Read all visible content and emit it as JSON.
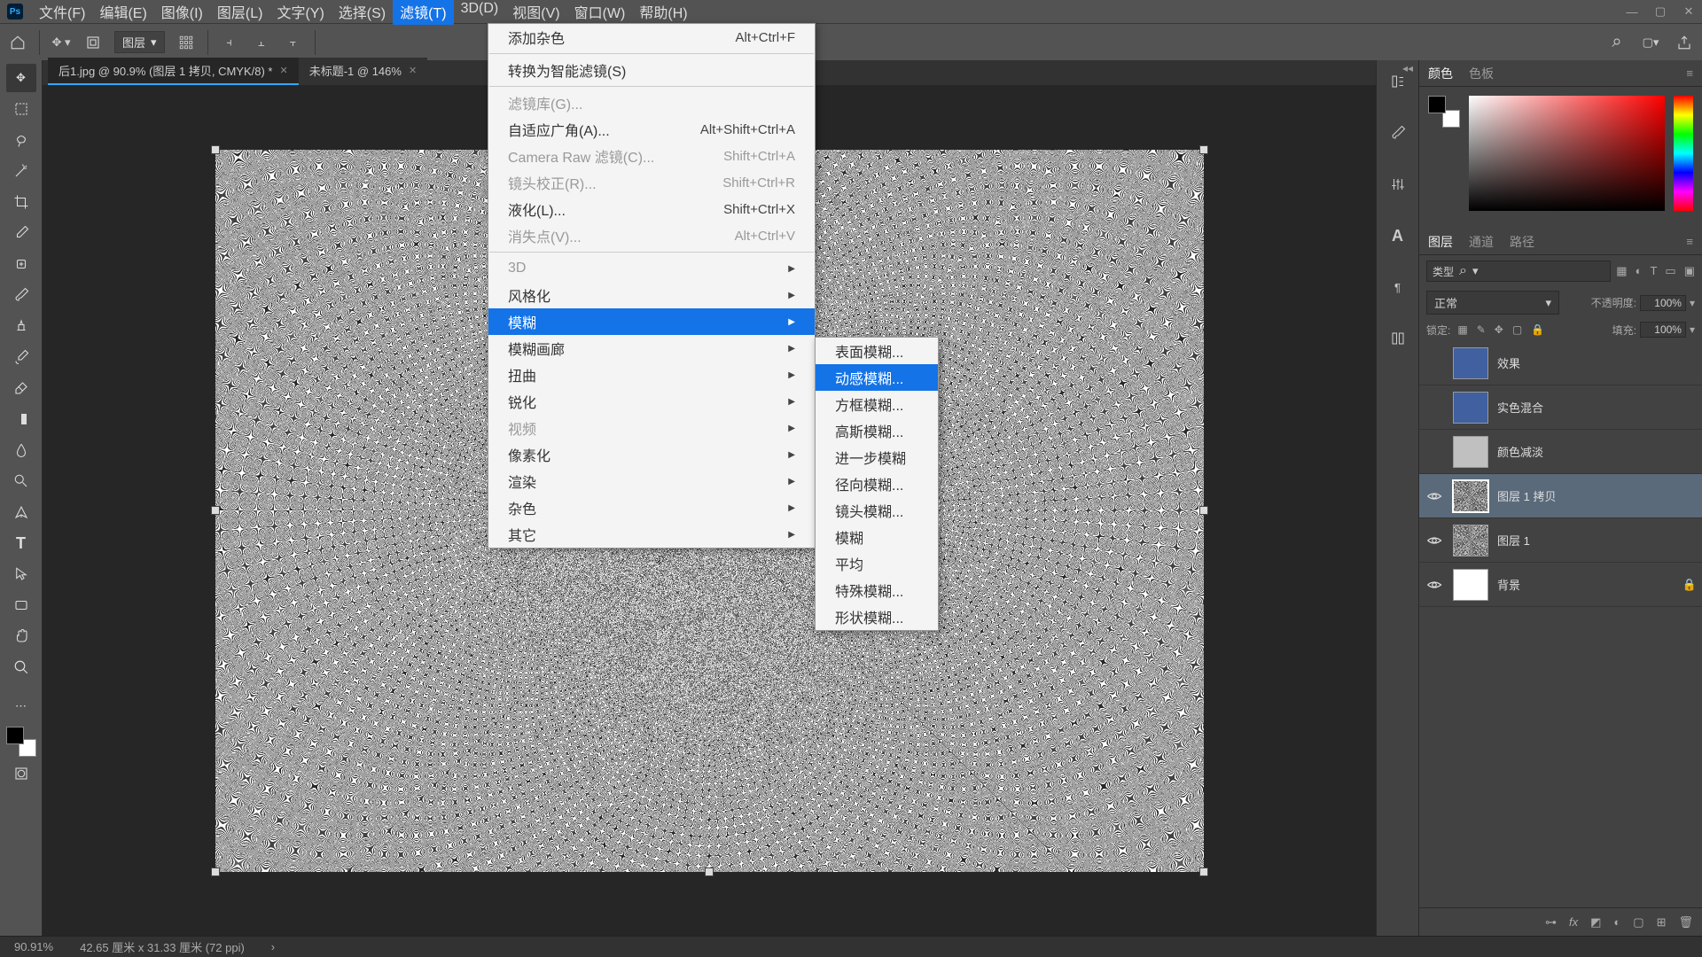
{
  "app": {
    "icon_text": "Ps"
  },
  "menubar": {
    "items": [
      "文件(F)",
      "编辑(E)",
      "图像(I)",
      "图层(L)",
      "文字(Y)",
      "选择(S)",
      "滤镜(T)",
      "3D(D)",
      "视图(V)",
      "窗口(W)",
      "帮助(H)"
    ],
    "active_index": 6
  },
  "optionsbar": {
    "dropdown1": "图层"
  },
  "tabs": [
    {
      "label": "后1.jpg @ 90.9% (图层 1 拷贝, CMYK/8) *",
      "active": true
    },
    {
      "label": "未标题-1 @ 146%",
      "active": false
    }
  ],
  "dropdown_main": [
    {
      "label": "添加杂色",
      "shortcut": "Alt+Ctrl+F"
    },
    {
      "sep": true
    },
    {
      "label": "转换为智能滤镜(S)"
    },
    {
      "sep": true
    },
    {
      "label": "滤镜库(G)...",
      "disabled": true
    },
    {
      "label": "自适应广角(A)...",
      "shortcut": "Alt+Shift+Ctrl+A"
    },
    {
      "label": "Camera Raw 滤镜(C)...",
      "shortcut": "Shift+Ctrl+A",
      "disabled": true
    },
    {
      "label": "镜头校正(R)...",
      "shortcut": "Shift+Ctrl+R",
      "disabled": true
    },
    {
      "label": "液化(L)...",
      "shortcut": "Shift+Ctrl+X"
    },
    {
      "label": "消失点(V)...",
      "shortcut": "Alt+Ctrl+V",
      "disabled": true
    },
    {
      "sep": true
    },
    {
      "label": "3D",
      "arrow": true,
      "disabled": true
    },
    {
      "label": "风格化",
      "arrow": true
    },
    {
      "label": "模糊",
      "arrow": true,
      "selected": true
    },
    {
      "label": "模糊画廊",
      "arrow": true
    },
    {
      "label": "扭曲",
      "arrow": true
    },
    {
      "label": "锐化",
      "arrow": true
    },
    {
      "label": "视频",
      "arrow": true,
      "disabled": true
    },
    {
      "label": "像素化",
      "arrow": true
    },
    {
      "label": "渲染",
      "arrow": true
    },
    {
      "label": "杂色",
      "arrow": true
    },
    {
      "label": "其它",
      "arrow": true
    }
  ],
  "submenu": [
    {
      "label": "表面模糊..."
    },
    {
      "label": "动感模糊...",
      "selected": true
    },
    {
      "label": "方框模糊..."
    },
    {
      "label": "高斯模糊..."
    },
    {
      "label": "进一步模糊"
    },
    {
      "label": "径向模糊..."
    },
    {
      "label": "镜头模糊..."
    },
    {
      "label": "模糊"
    },
    {
      "label": "平均"
    },
    {
      "label": "特殊模糊..."
    },
    {
      "label": "形状模糊..."
    }
  ],
  "right_tabs": {
    "color": "颜色",
    "swatches": "色板",
    "layers": "图层",
    "channels": "通道",
    "paths": "路径"
  },
  "layers": {
    "kind_label": "类型",
    "blend_mode": "正常",
    "opacity_label": "不透明度:",
    "opacity_value": "100%",
    "lock_label": "锁定:",
    "fill_label": "填充:",
    "fill_value": "100%",
    "items": [
      {
        "name": "效果",
        "visible": false,
        "thumb": "blue"
      },
      {
        "name": "实色混合",
        "visible": false,
        "thumb": "blue"
      },
      {
        "name": "颜色减淡",
        "visible": false,
        "thumb": "light"
      },
      {
        "name": "图层 1 拷贝",
        "visible": true,
        "thumb": "noise",
        "selected": true
      },
      {
        "name": "图层 1",
        "visible": true,
        "thumb": "noise"
      },
      {
        "name": "背景",
        "visible": true,
        "thumb": "white",
        "locked": true
      }
    ]
  },
  "status": {
    "zoom": "90.91%",
    "dims": "42.65 厘米 x 31.33 厘米 (72 ppi)"
  },
  "search_icon": "⌕"
}
